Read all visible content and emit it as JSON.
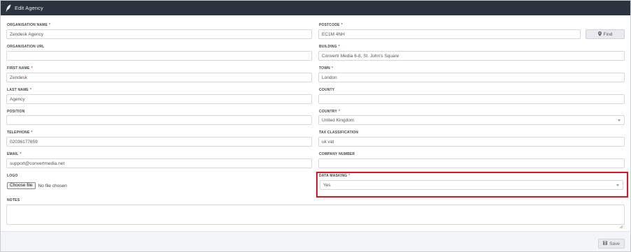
{
  "header": {
    "title": "Edit Agency",
    "icon": "feather-icon"
  },
  "form": {
    "organisation_name": {
      "label": "ORGANISATION NAME",
      "required": "*",
      "value": "Zendesk Agency"
    },
    "organisation_url": {
      "label": "ORGANISATION URL",
      "value": ""
    },
    "first_name": {
      "label": "FIRST NAME",
      "required": "*",
      "value": "Zendesk"
    },
    "last_name": {
      "label": "LAST NAME",
      "required": "*",
      "value": "Agency"
    },
    "position": {
      "label": "POSITION",
      "value": ""
    },
    "telephone": {
      "label": "TELEPHONE",
      "required": "*",
      "value": "02036177659"
    },
    "email": {
      "label": "EMAIL",
      "required": "*",
      "value": "support@convertmedia.net"
    },
    "logo": {
      "label": "LOGO",
      "button": "Choose file",
      "status": "No file chosen"
    },
    "postcode": {
      "label": "POSTCODE",
      "required": "*",
      "value": "EC1M 4NH",
      "find_label": "Find"
    },
    "building": {
      "label": "BUILDING",
      "required": "*",
      "value": "Convertr Media 6-8, St. John's Square"
    },
    "town": {
      "label": "TOWN",
      "required": "*",
      "value": "London"
    },
    "county": {
      "label": "COUNTY",
      "value": ""
    },
    "country": {
      "label": "COUNTRY",
      "required": "*",
      "value": "United Kingdom"
    },
    "tax_classification": {
      "label": "TAX CLASSIFICATION",
      "value": "uk vat"
    },
    "company_number": {
      "label": "COMPANY NUMBER",
      "value": ""
    },
    "data_masking": {
      "label": "DATA MASKING",
      "required": "*",
      "value": "Yes"
    },
    "notes": {
      "label": "NOTES",
      "value": ""
    }
  },
  "footer": {
    "save_label": "Save"
  },
  "colors": {
    "header_bg": "#2b333e",
    "required": "#d9363e",
    "highlight": "#e0141e"
  }
}
